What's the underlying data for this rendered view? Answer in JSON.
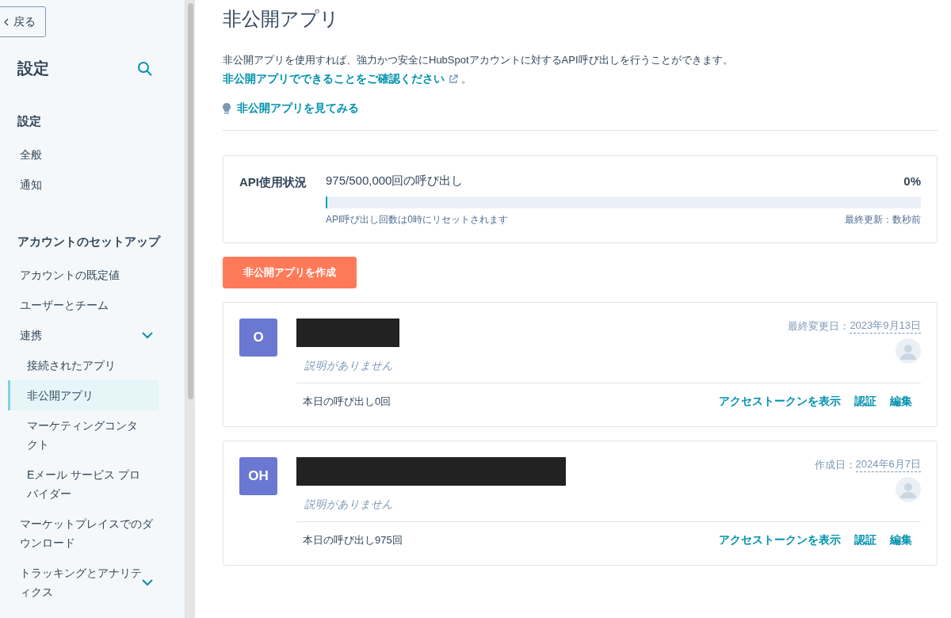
{
  "sidebar": {
    "back_button": "戻る",
    "title": "設定",
    "sections": [
      {
        "heading": "設定",
        "items": [
          {
            "label": "全般",
            "selected": false
          },
          {
            "label": "通知",
            "selected": false
          }
        ]
      },
      {
        "heading": "アカウントのセットアップ",
        "items": [
          {
            "label": "アカウントの既定値",
            "selected": false
          },
          {
            "label": "ユーザーとチーム",
            "selected": false
          },
          {
            "label": "連携",
            "selected": false,
            "expanded": true,
            "children": [
              {
                "label": "接続されたアプリ",
                "selected": false
              },
              {
                "label": "非公開アプリ",
                "selected": true
              },
              {
                "label": "マーケティングコンタクト",
                "selected": false
              },
              {
                "label": "Eメール サービス プロバイダー",
                "selected": false
              }
            ]
          },
          {
            "label": "マーケットプレイスでのダウンロード",
            "selected": false
          },
          {
            "label": "トラッキングとアナリティクス",
            "selected": false,
            "expanded": true
          }
        ]
      }
    ]
  },
  "page": {
    "title": "非公開アプリ",
    "description": "非公開アプリを使用すれば、強力かつ安全にHubSpotアカウントに対するAPI呼び出しを行うことができます。",
    "learn_link": "非公開アプリでできることをご確認ください",
    "learn_suffix": "。",
    "explore_link": "非公開アプリを見てみる"
  },
  "api_usage": {
    "label": "API使用状況",
    "calls": "975/500,000回の呼び出し",
    "percent": "0%",
    "level": 0.002,
    "reset_note": "API呼び出し回数は0時にリセットされます",
    "updated": "最終更新：数秒前"
  },
  "create_button": "非公開アプリを作成",
  "apps": [
    {
      "initials": "O",
      "description": "説明がありません",
      "date_label": "最終変更日：",
      "date": "2023年9月13日",
      "calls_today": "本日の呼び出し0回",
      "actions": [
        "アクセストークンを表示",
        "認証",
        "編集"
      ]
    },
    {
      "initials": "OH",
      "description": "説明がありません",
      "date_label": "作成日：",
      "date": "2024年6月7日",
      "calls_today": "本日の呼び出し975回",
      "actions": [
        "アクセストークンを表示",
        "認証",
        "編集"
      ]
    }
  ]
}
